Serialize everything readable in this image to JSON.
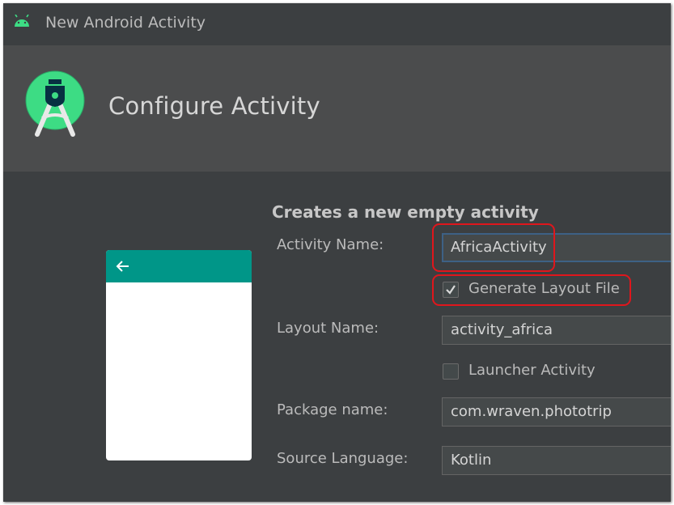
{
  "window": {
    "title": "New Android Activity"
  },
  "header": {
    "title": "Configure Activity"
  },
  "form": {
    "description": "Creates a new empty activity",
    "activity_name": {
      "label": "Activity Name:",
      "value": "AfricaActivity"
    },
    "generate_layout": {
      "label": "Generate Layout File",
      "checked": true
    },
    "layout_name": {
      "label": "Layout Name:",
      "value": "activity_africa"
    },
    "launcher_activity": {
      "label": "Launcher Activity",
      "checked": false
    },
    "package_name": {
      "label": "Package name:",
      "value": "com.wraven.phototrip"
    },
    "source_language": {
      "label": "Source Language:",
      "value": "Kotlin"
    }
  },
  "colors": {
    "window_bg": "#3c3f41",
    "header_bg": "#4b4c4d",
    "preview_appbar": "#009688",
    "highlight": "#e0161c",
    "android_green": "#3ddc84"
  },
  "icons": {
    "titlebar": "android-droid-icon",
    "header": "android-studio-logo-icon",
    "preview_back": "arrow-left-icon"
  }
}
